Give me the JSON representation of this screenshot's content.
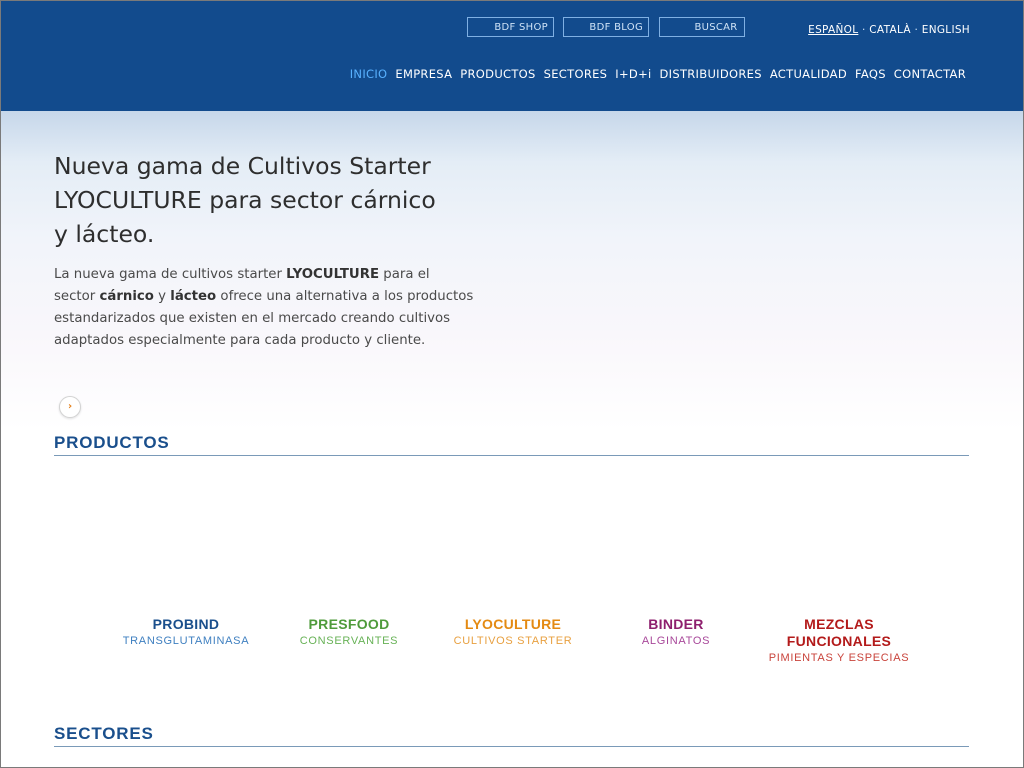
{
  "header": {
    "top_buttons": [
      {
        "label": "BDF SHOP"
      },
      {
        "label": "BDF BLOG"
      },
      {
        "label": "BUSCAR"
      }
    ],
    "languages": [
      {
        "label": "ESPAÑOL",
        "active": true
      },
      {
        "label": "CATALÀ",
        "active": false
      },
      {
        "label": "ENGLISH",
        "active": false
      }
    ],
    "language_separator": "·",
    "nav": [
      {
        "label": "INICIO",
        "active": true
      },
      {
        "label": "EMPRESA",
        "active": false
      },
      {
        "label": "PRODUCTOS",
        "active": false
      },
      {
        "label": "SECTORES",
        "active": false
      },
      {
        "label": "I+D+i",
        "active": false
      },
      {
        "label": "DISTRIBUIDORES",
        "active": false
      },
      {
        "label": "ACTUALIDAD",
        "active": false
      },
      {
        "label": "FAQS",
        "active": false
      },
      {
        "label": "CONTACTAR",
        "active": false
      }
    ]
  },
  "hero": {
    "title_lines": [
      "Nueva gama de Cultivos Starter",
      "LYOCULTURE para sector cárnico",
      "y lácteo."
    ],
    "body": {
      "t1": "La nueva gama de cultivos starter ",
      "b1": "LYOCULTURE",
      "t2": " para el sector ",
      "b2": "cárnico",
      "t3": " y ",
      "b3": "lácteo",
      "t4": " ofrece una alternativa a los productos estandarizados que existen en el mercado creando cultivos adaptados especialmente para cada producto y cliente."
    },
    "more_icon": "chevron-right-icon",
    "more_glyph": "›"
  },
  "productos": {
    "title": "PRODUCTOS",
    "items": [
      {
        "name": "PROBIND",
        "subtitle": "TRANSGLUTAMINASA",
        "name_color": "#1a4f8c",
        "sub_color": "#3e7fc0"
      },
      {
        "name": "PRESFOOD",
        "subtitle": "CONSERVANTES",
        "name_color": "#4f9b3b",
        "sub_color": "#67b256"
      },
      {
        "name": "LYOCULTURE",
        "subtitle": "CULTIVOS STARTER",
        "name_color": "#e48a12",
        "sub_color": "#e8a040"
      },
      {
        "name": "BINDER",
        "subtitle": "ALGINATOS",
        "name_color": "#8e1f6e",
        "sub_color": "#a8489a"
      },
      {
        "name": "MEZCLAS FUNCIONALES",
        "subtitle": "PIMIENTAS Y ESPECIAS",
        "name_color": "#b31a1a",
        "sub_color": "#c9443c"
      }
    ]
  },
  "sectores": {
    "title": "SECTORES"
  },
  "colors": {
    "header_bg": "#124b8d",
    "nav_active": "#58b1ff",
    "section_title": "#1a4f8c"
  }
}
